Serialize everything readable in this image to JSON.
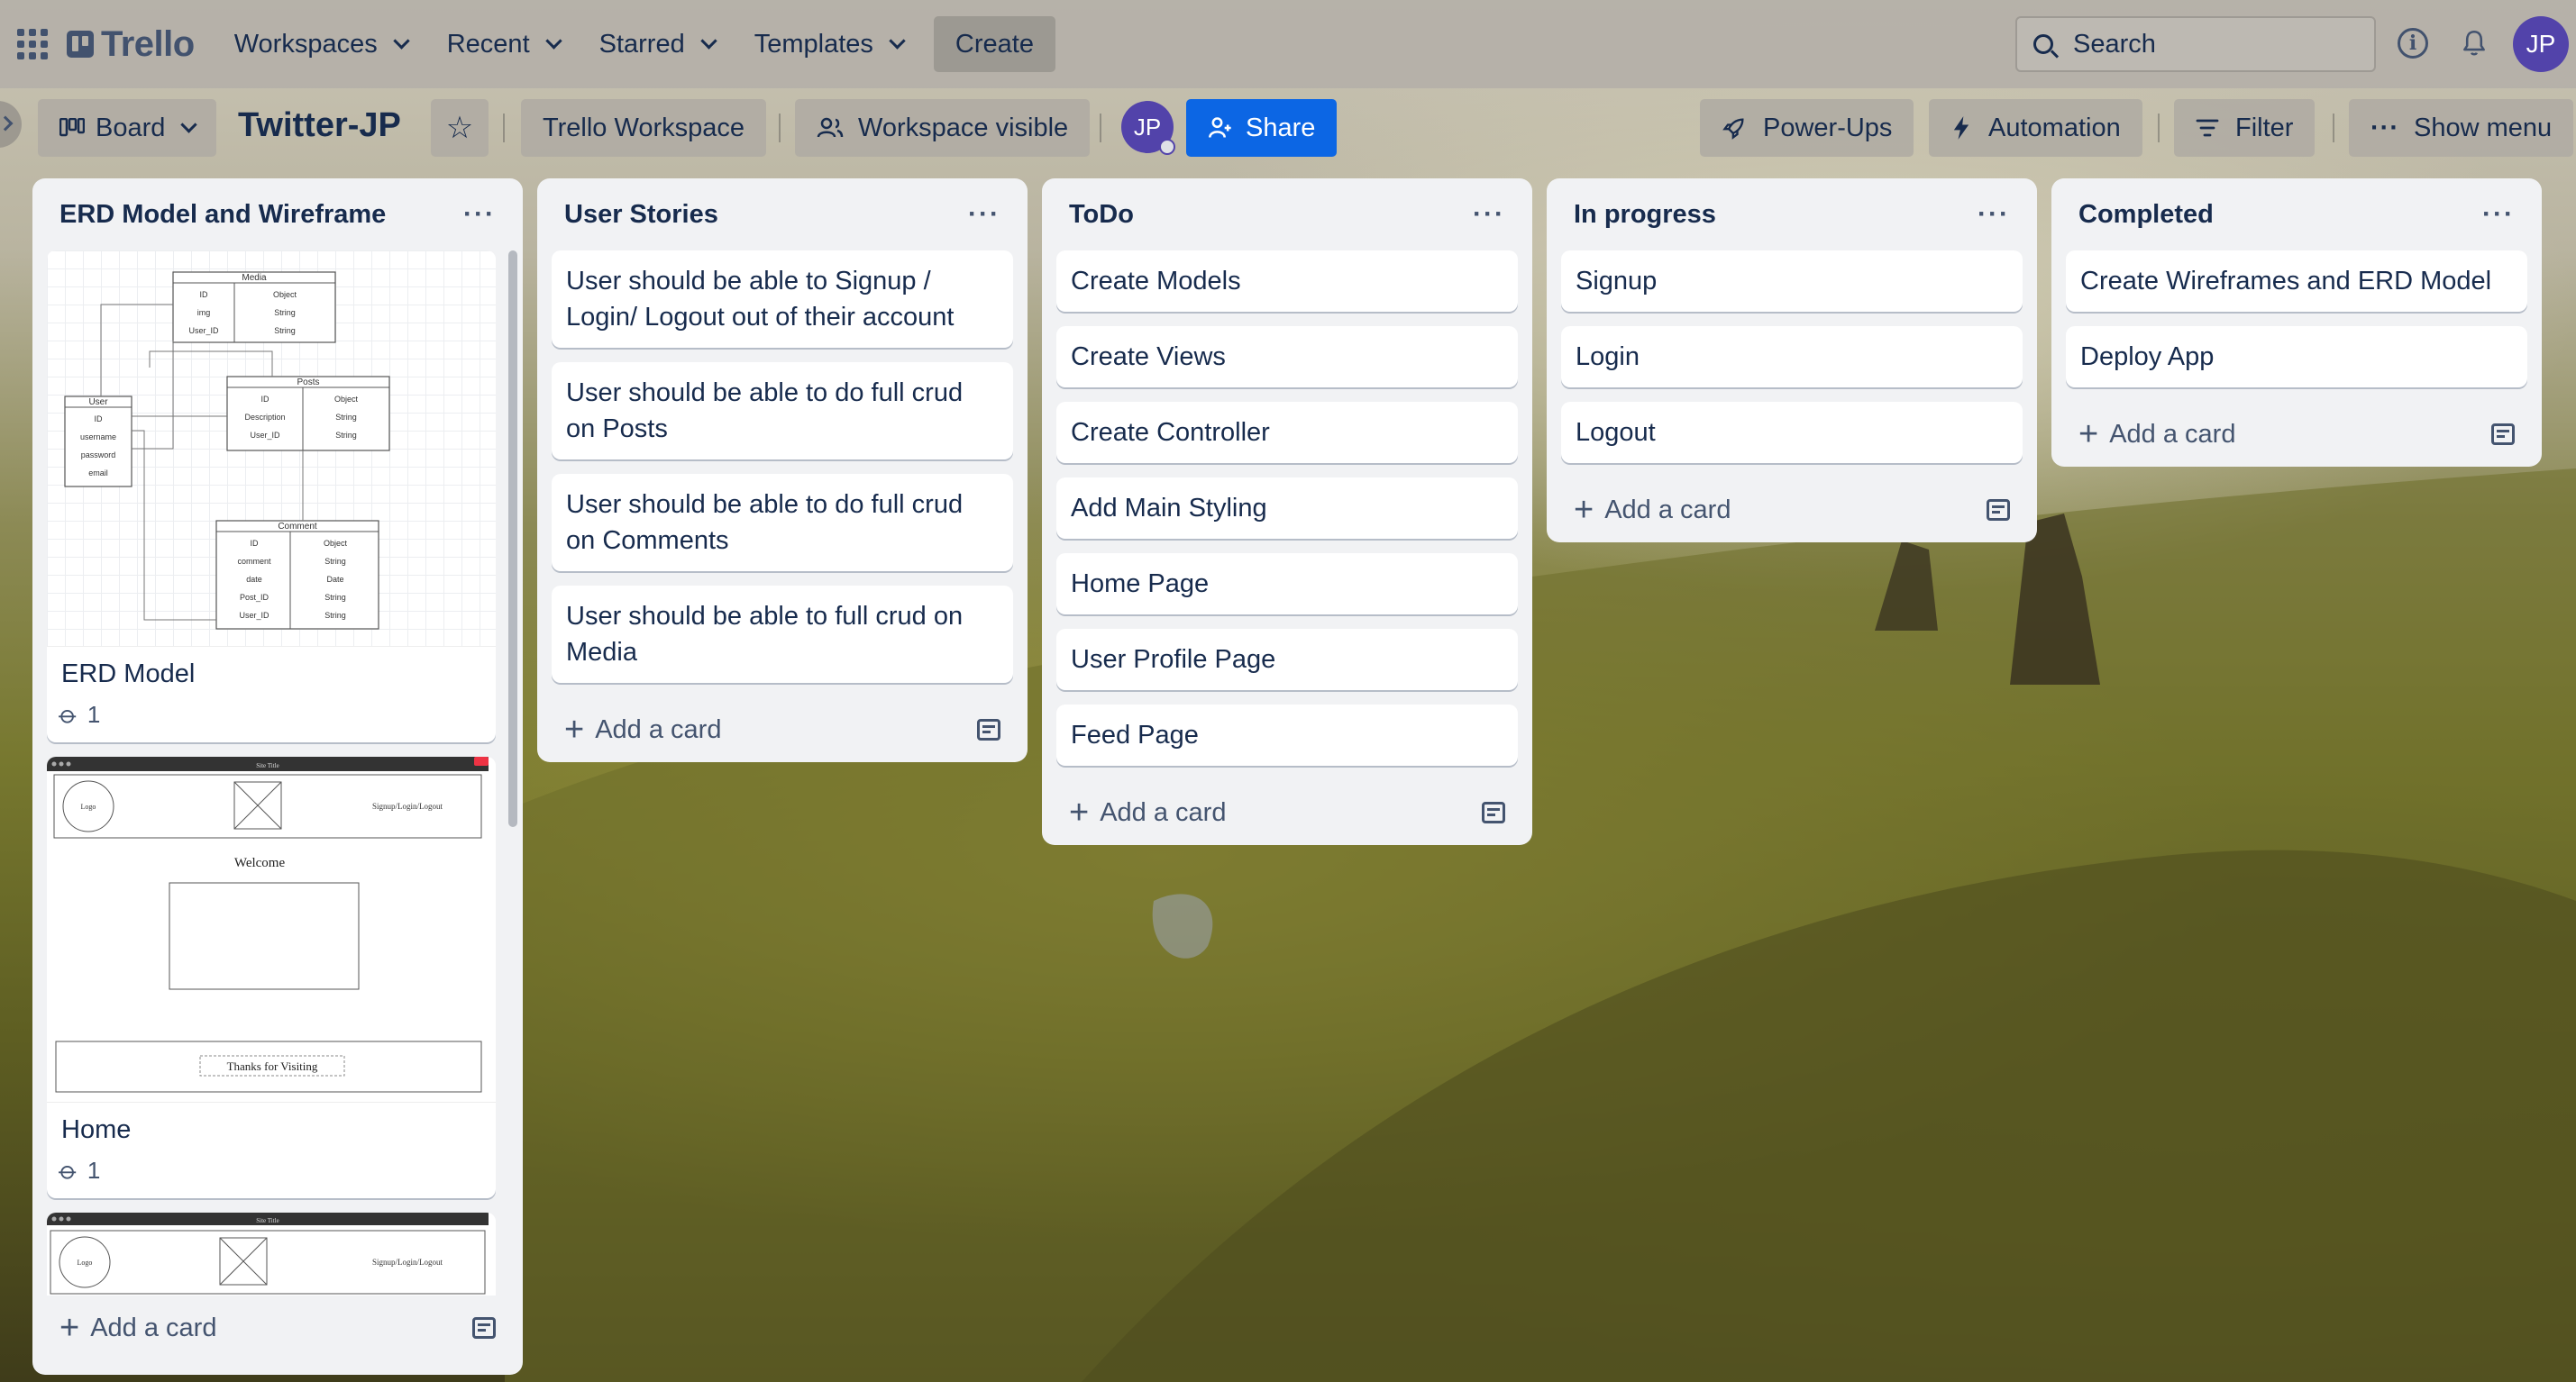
{
  "header": {
    "logo_text": "Trello",
    "nav": [
      "Workspaces",
      "Recent",
      "Starred",
      "Templates"
    ],
    "create_label": "Create",
    "search_placeholder": "Search",
    "avatar_initials": "JP"
  },
  "board": {
    "view_label": "Board",
    "title": "Twitter-JP",
    "workspace_label": "Trello Workspace",
    "visibility_label": "Workspace visible",
    "member_initials": "JP",
    "share_label": "Share",
    "powerups_label": "Power-Ups",
    "automation_label": "Automation",
    "filter_label": "Filter",
    "show_menu_label": "Show menu"
  },
  "add_card_label": "Add a card",
  "lists": [
    {
      "title": "ERD Model and Wireframe",
      "image_cards": [
        {
          "name": "ERD Model",
          "attachments": "1"
        },
        {
          "name": "Home",
          "attachments": "1"
        }
      ],
      "cards": []
    },
    {
      "title": "User Stories",
      "cards": [
        "User should be able to Signup / Login/ Logout out of their account",
        "User should be able to do full crud on Posts",
        "User should be able to do full crud on Comments",
        "User should be able to full crud on Media"
      ]
    },
    {
      "title": "ToDo",
      "cards": [
        "Create Models",
        "Create Views",
        "Create Controller",
        "Add Main Styling",
        "Home Page",
        "User Profile Page",
        "Feed Page"
      ]
    },
    {
      "title": "In progress",
      "cards": [
        "Signup",
        "Login",
        "Logout"
      ]
    },
    {
      "title": "Completed",
      "cards": [
        "Create Wireframes and ERD Model",
        "Deploy App"
      ]
    }
  ],
  "erd": {
    "media": {
      "title": "Media",
      "fields": [
        "ID",
        "img",
        "User_ID"
      ],
      "types": [
        "Object",
        "String",
        "String"
      ]
    },
    "posts": {
      "title": "Posts",
      "fields": [
        "ID",
        "Description",
        "User_ID"
      ],
      "types": [
        "Object",
        "String",
        "String"
      ]
    },
    "user": {
      "title": "User",
      "fields": [
        "ID",
        "username",
        "password",
        "email"
      ]
    },
    "comment": {
      "title": "Comment",
      "fields": [
        "ID",
        "comment",
        "date",
        "Post_ID",
        "User_ID"
      ],
      "types": [
        "Object",
        "String",
        "Date",
        "String",
        "String"
      ]
    }
  },
  "wireframe": {
    "site_title": "Site Title",
    "logo": "Logo",
    "nav_links": "Signup/Login/Logout",
    "welcome": "Welcome",
    "footer": "Thanks for Visiting"
  }
}
